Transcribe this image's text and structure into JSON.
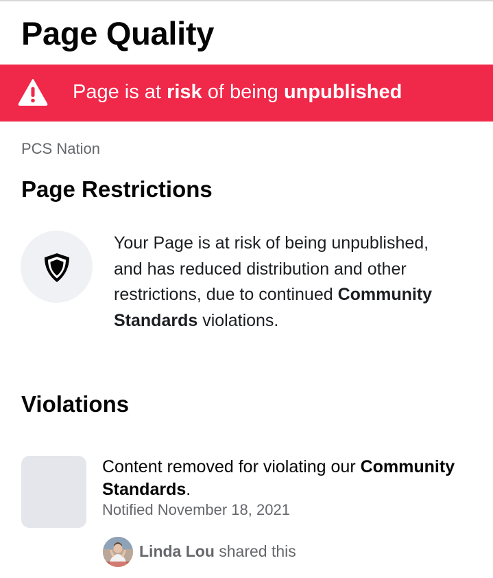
{
  "header": {
    "title": "Page Quality"
  },
  "banner": {
    "icon": "warning-icon",
    "text_prefix": "Page is at ",
    "text_risk": "risk",
    "text_middle": " of being ",
    "text_unpublished": "unpublished",
    "color": "#f02849"
  },
  "page": {
    "name": "PCS Nation"
  },
  "restrictions": {
    "heading": "Page Restrictions",
    "icon": "shield-icon",
    "text_before": "Your Page is at risk of being unpublished, and has reduced distribution and other restrictions, due to continued ",
    "text_bold": "Community Standards",
    "text_after": " violations."
  },
  "violations": {
    "heading": "Violations",
    "items": [
      {
        "text_before": "Content removed for violating our ",
        "text_bold": "Community Standards",
        "text_after": ".",
        "notified": "Notified November 18, 2021",
        "shared_by": "Linda Lou",
        "shared_suffix": " shared this"
      }
    ]
  }
}
